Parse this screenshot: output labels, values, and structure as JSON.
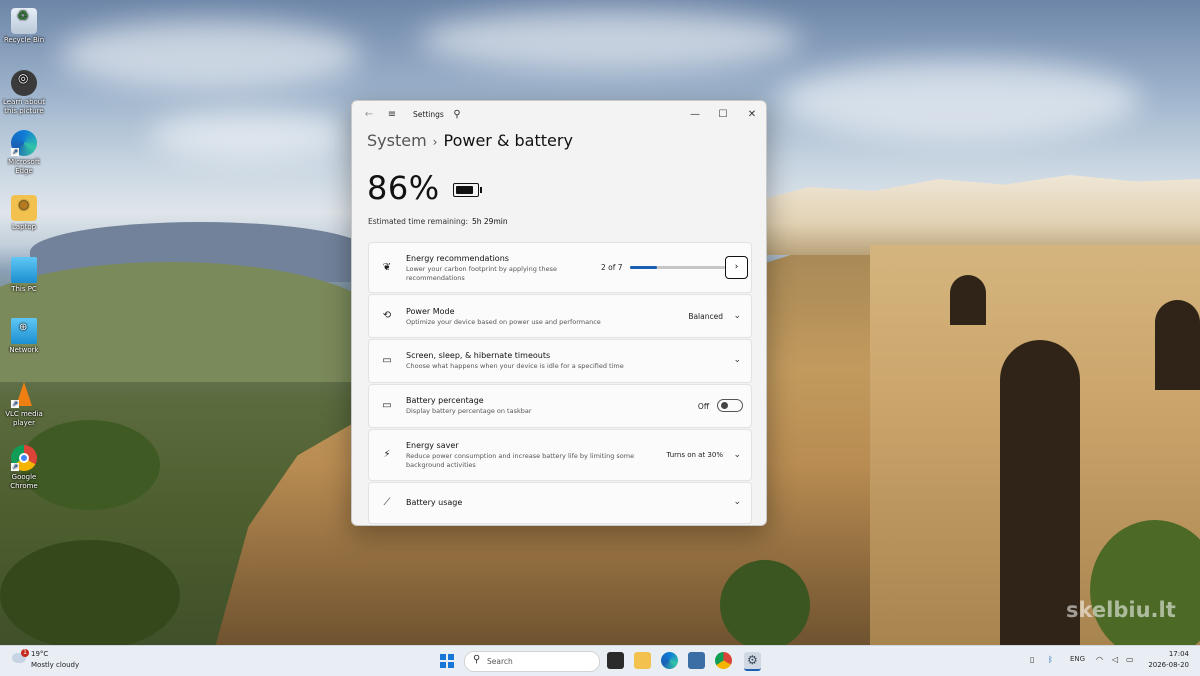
{
  "desktop": {
    "icons": [
      {
        "label": "Recycle Bin"
      },
      {
        "label": "Learn about this picture"
      },
      {
        "label": "Microsoft Edge"
      },
      {
        "label": "Laptop"
      },
      {
        "label": "This PC"
      },
      {
        "label": "Network"
      },
      {
        "label": "VLC media player"
      },
      {
        "label": "Google Chrome"
      }
    ],
    "watermark": "skelbiu.lt"
  },
  "window": {
    "title": "Settings",
    "breadcrumb_root": "System",
    "breadcrumb_current": "Power & battery",
    "battery_percent": "86%",
    "battery_level": 0.86,
    "estimated_label": "Estimated time remaining:",
    "estimated_value": "5h 29min",
    "cards": {
      "energy_recommendations": {
        "title": "Energy recommendations",
        "description": "Lower your carbon footprint by applying these recommendations",
        "count": "2 of 7",
        "progress": 0.2857
      },
      "power_mode": {
        "title": "Power Mode",
        "description": "Optimize your device based on power use and performance",
        "value": "Balanced"
      },
      "screen_sleep": {
        "title": "Screen, sleep, & hibernate timeouts",
        "description": "Choose what happens when your device is idle for a specified time"
      },
      "battery_percentage": {
        "title": "Battery percentage",
        "description": "Display battery percentage on taskbar",
        "value": "Off"
      },
      "energy_saver": {
        "title": "Energy saver",
        "description": "Reduce power consumption and increase battery life by limiting some background activities",
        "value": "Turns on at 30%"
      },
      "battery_usage": {
        "title": "Battery usage"
      }
    }
  },
  "taskbar": {
    "weather_temp": "19°C",
    "weather_condition": "Mostly cloudy",
    "weather_badge": "1",
    "search_placeholder": "Search",
    "language": "ENG",
    "time": "17:04",
    "date": "2026-08-20"
  },
  "colors": {
    "accent": "#1a5fb4",
    "window_bg": "#f3f3f3",
    "card_bg": "#fbfbfb",
    "taskbar_bg": "#e9eef5"
  }
}
